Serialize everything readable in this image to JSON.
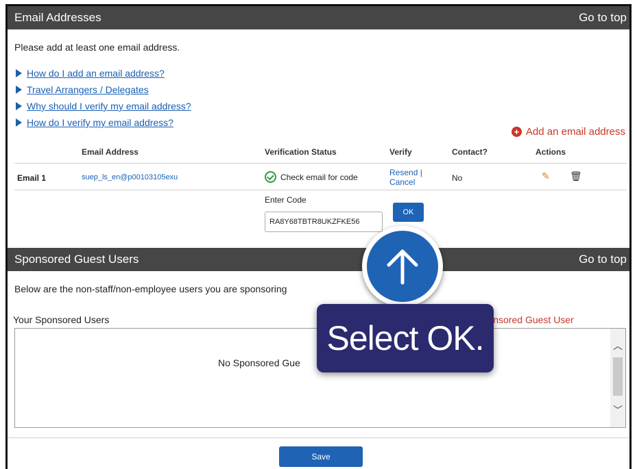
{
  "email_section": {
    "title": "Email Addresses",
    "goto_top": "Go to top",
    "intro": "Please add at least one email address.",
    "help_links": [
      "How do I add an email address?",
      "Travel Arrangers / Delegates",
      "Why should I verify my email address?",
      "How do I verify my email address?"
    ],
    "add_email": "Add an email address",
    "columns": {
      "email": "Email Address",
      "status": "Verification Status",
      "verify": "Verify",
      "contact": "Contact?",
      "actions": "Actions"
    },
    "row": {
      "label": "Email 1",
      "email": "suep_ls_en@p00103105exu",
      "status": "Check email for code",
      "resend": "Resend |",
      "cancel": "Cancel",
      "contact": "No"
    },
    "enter_code_label": "Enter Code",
    "code_value": "RA8Y68TBTR8UKZFKE56",
    "ok_label": "OK"
  },
  "sponsored_section": {
    "title": "Sponsored Guest Users",
    "goto_top": "Go to top",
    "intro": "Below are the non-staff/non-employee users you are sponsoring",
    "your_users_label": "Your Sponsored Users",
    "add_sponsored": "d a Sponsored Guest User",
    "empty_message": "No Sponsored Gue"
  },
  "footer": {
    "save_label": "Save"
  },
  "callout": {
    "text": "Select OK."
  },
  "colors": {
    "header_bar": "#464646",
    "link": "#1a5fb4",
    "accent_red": "#c6372a",
    "button_blue": "#1f63b5",
    "callout_navy": "#2b2a6f"
  }
}
